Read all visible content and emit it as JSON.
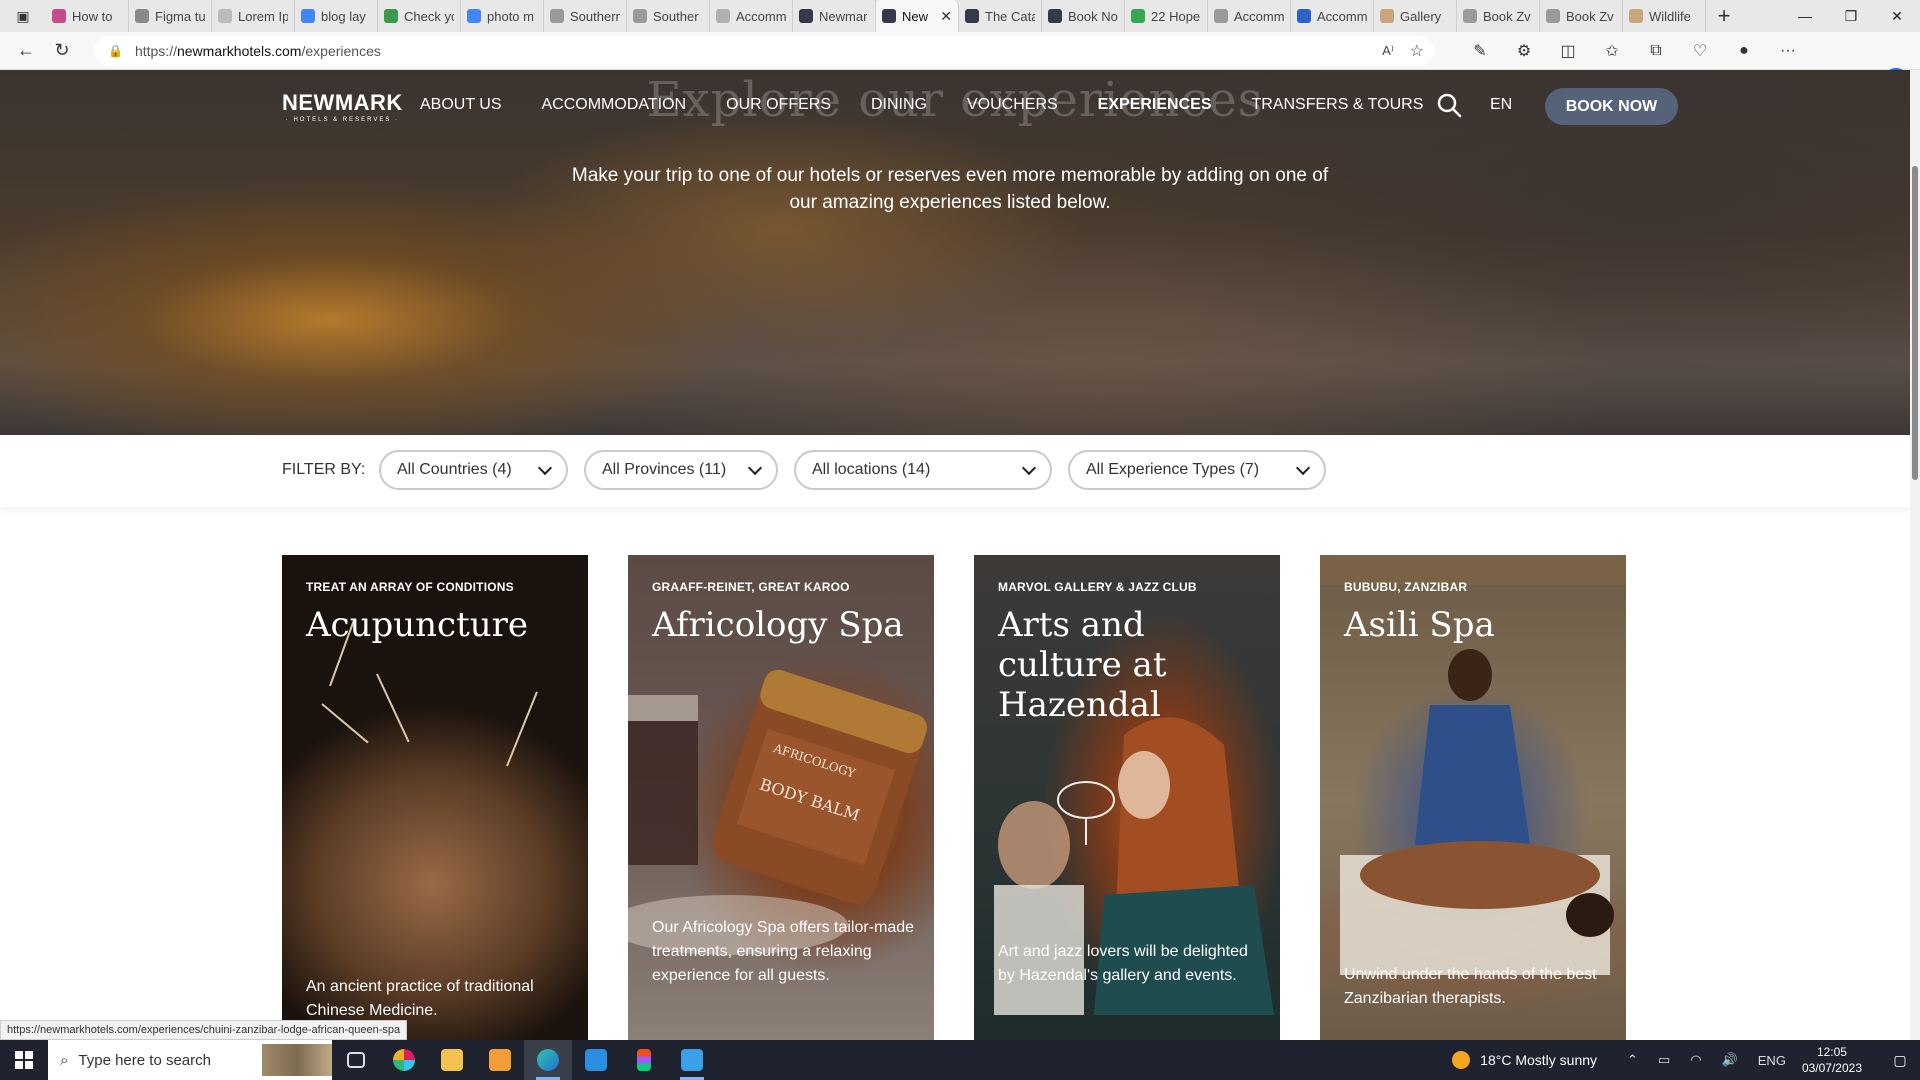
{
  "browser": {
    "tabs": [
      {
        "title": "How to",
        "fav_color": "#c64b8c"
      },
      {
        "title": "Figma tu",
        "fav_color": "#8a8a8a"
      },
      {
        "title": "Lorem Ip",
        "fav_color": "#bcbcbc"
      },
      {
        "title": "blog lay",
        "fav_color": "#4285f4"
      },
      {
        "title": "Check yc",
        "fav_color": "#3a9a4a"
      },
      {
        "title": "photo m",
        "fav_color": "#4285f4"
      },
      {
        "title": "Southern",
        "fav_color": "#9a9a9a"
      },
      {
        "title": "Souther",
        "fav_color": "#9a9a9a"
      },
      {
        "title": "Accomm",
        "fav_color": "#b0b0b0"
      },
      {
        "title": "Newmar",
        "fav_color": "#333b4a"
      },
      {
        "title": "New",
        "fav_color": "#333b4a",
        "active": true
      },
      {
        "title": "The Cata",
        "fav_color": "#333b4a"
      },
      {
        "title": "Book No",
        "fav_color": "#333b4a"
      },
      {
        "title": "22 Hope",
        "fav_color": "#34a853"
      },
      {
        "title": "Accomm",
        "fav_color": "#9a9a9a"
      },
      {
        "title": "Accomm",
        "fav_color": "#2b63c6"
      },
      {
        "title": "Gallery",
        "fav_color": "#c9a67a"
      },
      {
        "title": "Book Zv",
        "fav_color": "#9a9a9a"
      },
      {
        "title": "Book Zv",
        "fav_color": "#9a9a9a"
      },
      {
        "title": "Wildlife",
        "fav_color": "#c9a67a"
      }
    ],
    "url_prefix": "https://",
    "url_domain": "newmarkhotels.com",
    "url_path": "/experiences",
    "status_url": "https://newmarkhotels.com/experiences/chuini-zanzibar-lodge-african-queen-spa"
  },
  "site": {
    "logo_main": "NEWMARK",
    "logo_sub": "· HOTELS & RESERVES ·",
    "nav": [
      {
        "label": "ABOUT US"
      },
      {
        "label": "ACCOMMODATION"
      },
      {
        "label": "OUR OFFERS"
      },
      {
        "label": "DINING"
      },
      {
        "label": "VOUCHERS"
      },
      {
        "label": "EXPERIENCES",
        "current": true
      },
      {
        "label": "TRANSFERS & TOURS"
      }
    ],
    "lang": "EN",
    "book_now": "BOOK NOW",
    "hero_heading": "Explore our experiences",
    "hero_intro": "Make your trip to one of our hotels or reserves even more memorable by adding on one of our amazing experiences listed below."
  },
  "filters": {
    "label": "FILTER BY:",
    "items": [
      {
        "label": "All Countries (4)"
      },
      {
        "label": "All Provinces (11)"
      },
      {
        "label": "All locations (14)"
      },
      {
        "label": "All Experience Types (7)"
      }
    ]
  },
  "cards": [
    {
      "meta": "TREAT AN ARRAY OF CONDITIONS",
      "title": "Acupuncture",
      "desc": "An ancient practice of traditional Chinese Medicine."
    },
    {
      "meta": "GRAAFF-REINET, GREAT KAROO",
      "title": "Africology Spa",
      "desc": "Our Africology Spa offers tailor-made treatments, ensuring a relaxing experience for all guests.",
      "jar_label_1": "AFRICOLOGY",
      "jar_label_2": "BODY BALM"
    },
    {
      "meta": "MARVOL GALLERY & JAZZ CLUB",
      "title": "Arts and culture at Hazendal",
      "desc": "Art and jazz lovers will be delighted by Hazendal's gallery and events."
    },
    {
      "meta": "BUBUBU, ZANZIBAR",
      "title": "Asili Spa",
      "desc": "Unwind under the hands of the best Zanzibarian therapists."
    }
  ],
  "taskbar": {
    "search_placeholder": "Type here to search",
    "weather": "18°C  Mostly sunny",
    "lang": "ENG",
    "time": "12:05",
    "date": "03/07/2023"
  }
}
